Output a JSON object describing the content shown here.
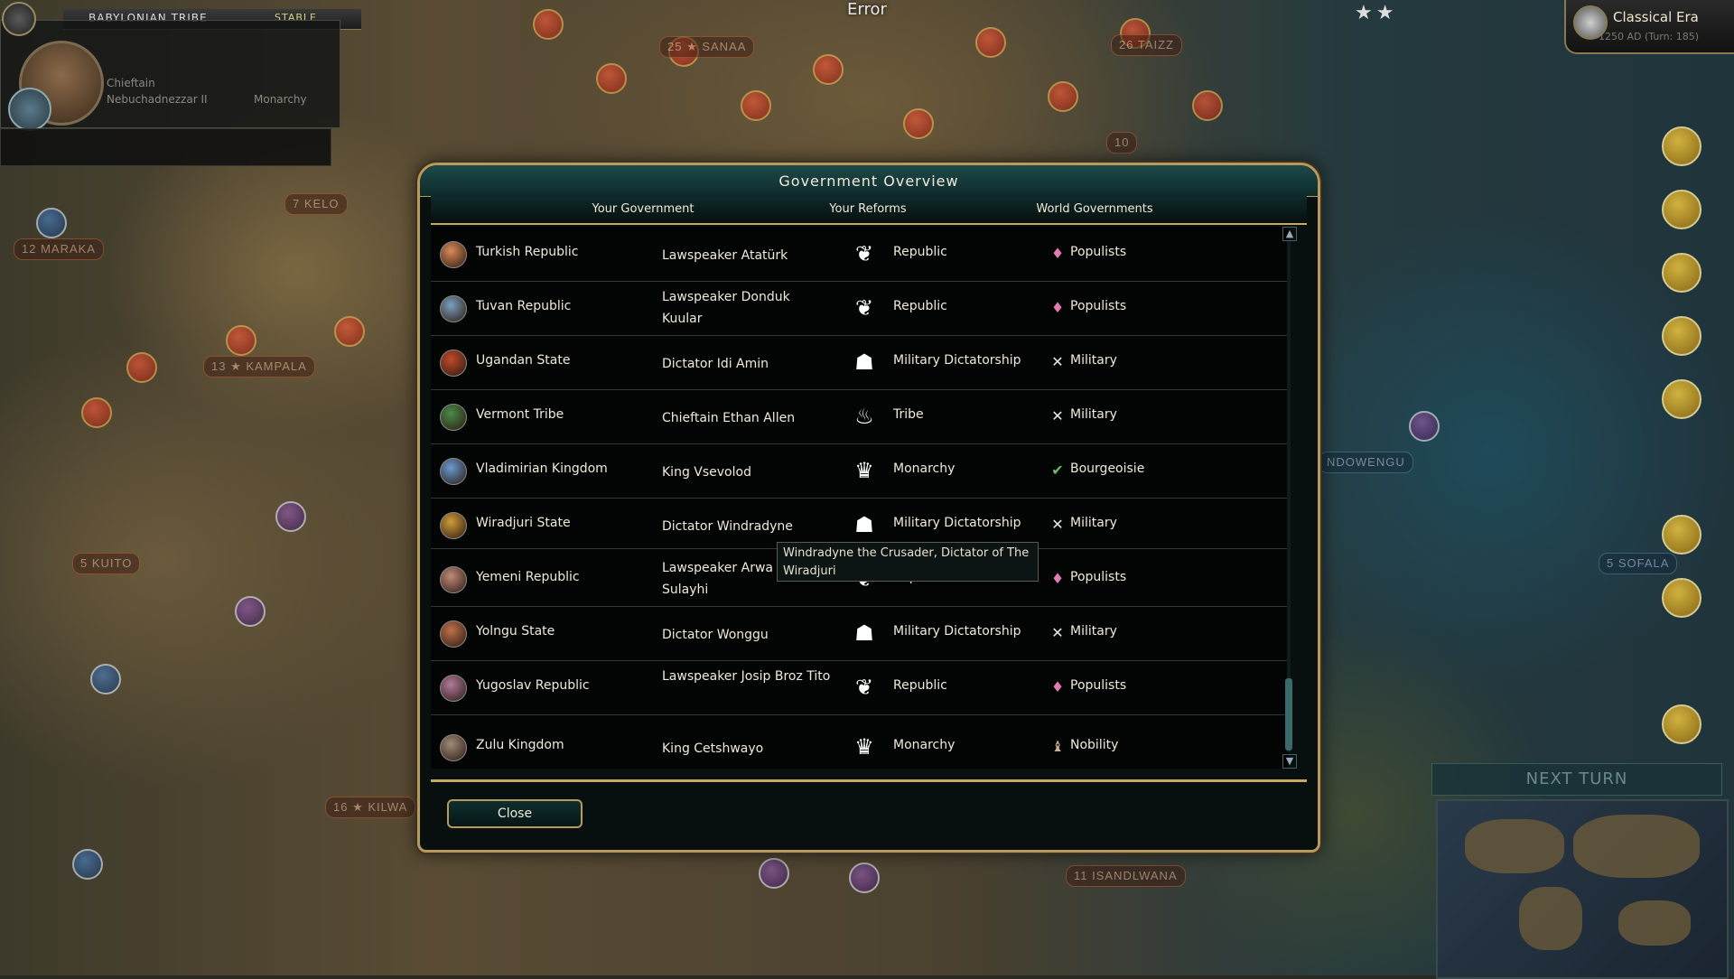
{
  "civ_panel": {
    "civ_name": "BABYLONIAN TRIBE",
    "status": "STABLE",
    "leader_title": "Chieftain",
    "leader_name": "Nebuchadnezzar II",
    "government": "Monarchy"
  },
  "top": {
    "error_label": "Error",
    "era_name": "Classical Era",
    "era_turn": "1250 AD (Turn: 185)"
  },
  "dialog": {
    "title": "Government Overview",
    "tabs": [
      "Your Government",
      "Your Reforms",
      "World Governments"
    ],
    "close_label": "Close",
    "scroll_up": "▲",
    "scroll_down": "▼"
  },
  "rows": [
    {
      "civ": "Turkish Republic",
      "leader": "Lawspeaker Atatürk",
      "government": "Republic",
      "faction": "Populists",
      "civ_color": "#d98a5a",
      "gov_icon": "laurel-icon",
      "faction_icon": "populists-icon"
    },
    {
      "civ": "Tuvan Republic",
      "leader": "Lawspeaker Donduk Kuular",
      "government": "Republic",
      "faction": "Populists",
      "civ_color": "#7aa0c0",
      "gov_icon": "laurel-icon",
      "faction_icon": "populists-icon"
    },
    {
      "civ": "Ugandan State",
      "leader": "Dictator Idi Amin",
      "government": "Military Dictatorship",
      "faction": "Military",
      "civ_color": "#c04a2a",
      "gov_icon": "helmet-icon",
      "faction_icon": "crossed-swords-icon"
    },
    {
      "civ": "Vermont Tribe",
      "leader": "Chieftain Ethan Allen",
      "government": "Tribe",
      "faction": "Military",
      "civ_color": "#4a8a4a",
      "gov_icon": "campfire-icon",
      "faction_icon": "crossed-swords-icon"
    },
    {
      "civ": "Vladimirian Kingdom",
      "leader": "King Vsevolod",
      "government": "Monarchy",
      "faction": "Bourgeoisie",
      "civ_color": "#6a9ad0",
      "gov_icon": "crown-icon",
      "faction_icon": "bourgeoisie-icon"
    },
    {
      "civ": "Wiradjuri State",
      "leader": "Dictator Windradyne",
      "government": "Military Dictatorship",
      "faction": "Military",
      "civ_color": "#d09a3a",
      "gov_icon": "helmet-icon",
      "faction_icon": "crossed-swords-icon"
    },
    {
      "civ": "Yemeni Republic",
      "leader": "Lawspeaker Arwa al-Sulayhi",
      "government": "Republic",
      "faction": "Populists",
      "civ_color": "#c08a7a",
      "gov_icon": "laurel-icon",
      "faction_icon": "populists-icon"
    },
    {
      "civ": "Yolngu State",
      "leader": "Dictator Wonggu",
      "government": "Military Dictatorship",
      "faction": "Military",
      "civ_color": "#c0704a",
      "gov_icon": "helmet-icon",
      "faction_icon": "crossed-swords-icon"
    },
    {
      "civ": "Yugoslav Republic",
      "leader": "Lawspeaker Josip Broz Tito",
      "government": "Republic",
      "faction": "Populists",
      "civ_color": "#b07a9a",
      "gov_icon": "laurel-icon",
      "faction_icon": "populists-icon"
    },
    {
      "civ": "Zulu Kingdom",
      "leader": "King Cetshwayo",
      "government": "Monarchy",
      "faction": "Nobility",
      "civ_color": "#a08a7a",
      "gov_icon": "crown-icon",
      "faction_icon": "nobility-icon"
    }
  ],
  "tooltip": "Windradyne the Crusader, Dictator of The Wiradjuri",
  "map": {
    "next_turn": "NEXT TURN",
    "cities": [
      {
        "label": "25 ★ SANAA"
      },
      {
        "label": "26 TAIZZ"
      },
      {
        "label": "7 KELO"
      },
      {
        "label": "12 MARAKA"
      },
      {
        "label": "13 ★ KAMPALA"
      },
      {
        "label": "5 KUITO"
      },
      {
        "label": "16 ★ KILWA"
      },
      {
        "label": "11 ISANDLWANA"
      },
      {
        "label": "NDOWENGU"
      },
      {
        "label": "5 SOFALA"
      },
      {
        "label": "10"
      }
    ]
  }
}
